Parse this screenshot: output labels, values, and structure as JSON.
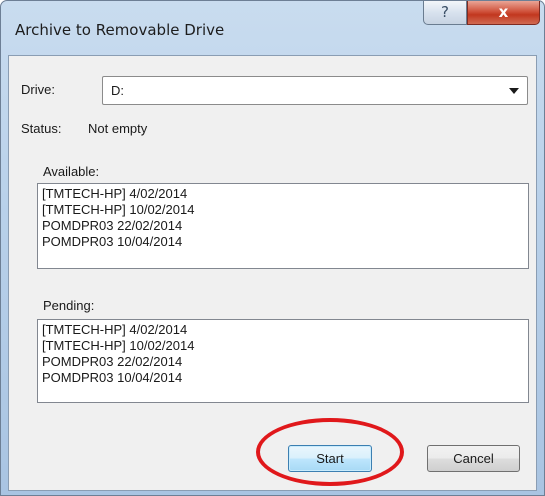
{
  "window": {
    "title": "Archive to Removable Drive",
    "help_glyph": "?",
    "close_glyph": "x"
  },
  "drive": {
    "label": "Drive:",
    "value": "D:"
  },
  "status": {
    "label": "Status:",
    "value": "Not empty"
  },
  "available": {
    "label": "Available:",
    "items": [
      "[TMTECH-HP] 4/02/2014",
      "[TMTECH-HP] 10/02/2014",
      "POMDPR03 22/02/2014",
      "POMDPR03 10/04/2014"
    ]
  },
  "pending": {
    "label": "Pending:",
    "items": [
      "[TMTECH-HP] 4/02/2014",
      "[TMTECH-HP] 10/02/2014",
      "POMDPR03 22/02/2014",
      "POMDPR03 10/04/2014"
    ]
  },
  "buttons": {
    "start": "Start",
    "cancel": "Cancel"
  },
  "annotation": {
    "ring_color": "#e0181b",
    "target": "start-button"
  }
}
